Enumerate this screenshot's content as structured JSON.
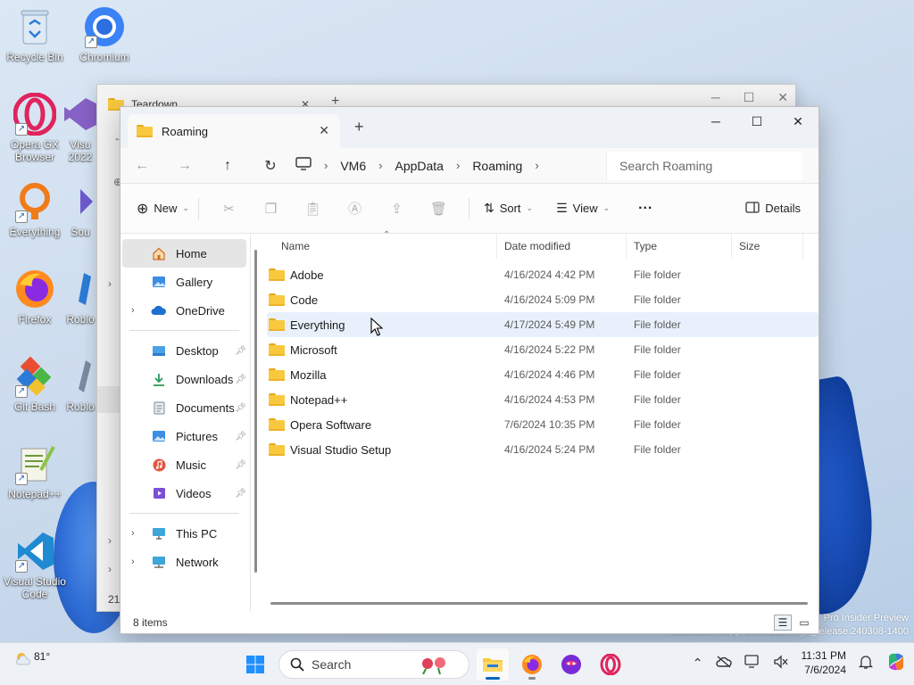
{
  "desktop": {
    "icons": [
      {
        "label": "Recycle Bin"
      },
      {
        "label": "Chromium"
      },
      {
        "label": "Opera GX Browser"
      },
      {
        "label": "Visu 2022"
      },
      {
        "label": "Everything"
      },
      {
        "label": "Sou"
      },
      {
        "label": "Firefox"
      },
      {
        "label": "Roblo"
      },
      {
        "label": "Git Bash"
      },
      {
        "label": "Roblo"
      },
      {
        "label": "Notepad++"
      },
      {
        "label": "Visual Studio Code"
      }
    ],
    "watermark_line1": "Pro Insider Preview",
    "watermark_line2": "Evaluation copy. Build 26100.ge_release.240308-1400"
  },
  "background_window": {
    "tab_title": "Teardown",
    "side_count": "21"
  },
  "window": {
    "tab_title": "Roaming",
    "tab_close": "✕",
    "new_tab": "+",
    "caption": {
      "minimize": "─",
      "maximize": "☐",
      "close": "✕"
    },
    "address": {
      "crumbs": [
        "VM6",
        "AppData",
        "Roaming"
      ],
      "search_placeholder": "Search Roaming"
    },
    "commands": {
      "new_label": "New",
      "sort_label": "Sort",
      "view_label": "View",
      "more_label": "···",
      "details_label": "Details"
    },
    "nav": {
      "home": "Home",
      "gallery": "Gallery",
      "onedrive": "OneDrive",
      "desktop": "Desktop",
      "downloads": "Downloads",
      "documents": "Documents",
      "pictures": "Pictures",
      "music": "Music",
      "videos": "Videos",
      "thispc": "This PC",
      "network": "Network"
    },
    "columns": {
      "name": "Name",
      "date": "Date modified",
      "type": "Type",
      "size": "Size"
    },
    "rows": [
      {
        "name": "Adobe",
        "date": "4/16/2024 4:42 PM",
        "type": "File folder"
      },
      {
        "name": "Code",
        "date": "4/16/2024 5:09 PM",
        "type": "File folder"
      },
      {
        "name": "Everything",
        "date": "4/17/2024 5:49 PM",
        "type": "File folder"
      },
      {
        "name": "Microsoft",
        "date": "4/16/2024 5:22 PM",
        "type": "File folder"
      },
      {
        "name": "Mozilla",
        "date": "4/16/2024 4:46 PM",
        "type": "File folder"
      },
      {
        "name": "Notepad++",
        "date": "4/16/2024 4:53 PM",
        "type": "File folder"
      },
      {
        "name": "Opera Software",
        "date": "7/6/2024 10:35 PM",
        "type": "File folder"
      },
      {
        "name": "Visual Studio Setup",
        "date": "4/16/2024 5:24 PM",
        "type": "File folder"
      }
    ],
    "status": "8 items"
  },
  "taskbar": {
    "weather_temp": "81°",
    "search_label": "Search",
    "time": "11:31 PM",
    "date": "7/6/2024"
  },
  "colors": {
    "accent": "#0067c0",
    "folder": "#f8c93f",
    "row_hover": "#e8f1fb"
  }
}
